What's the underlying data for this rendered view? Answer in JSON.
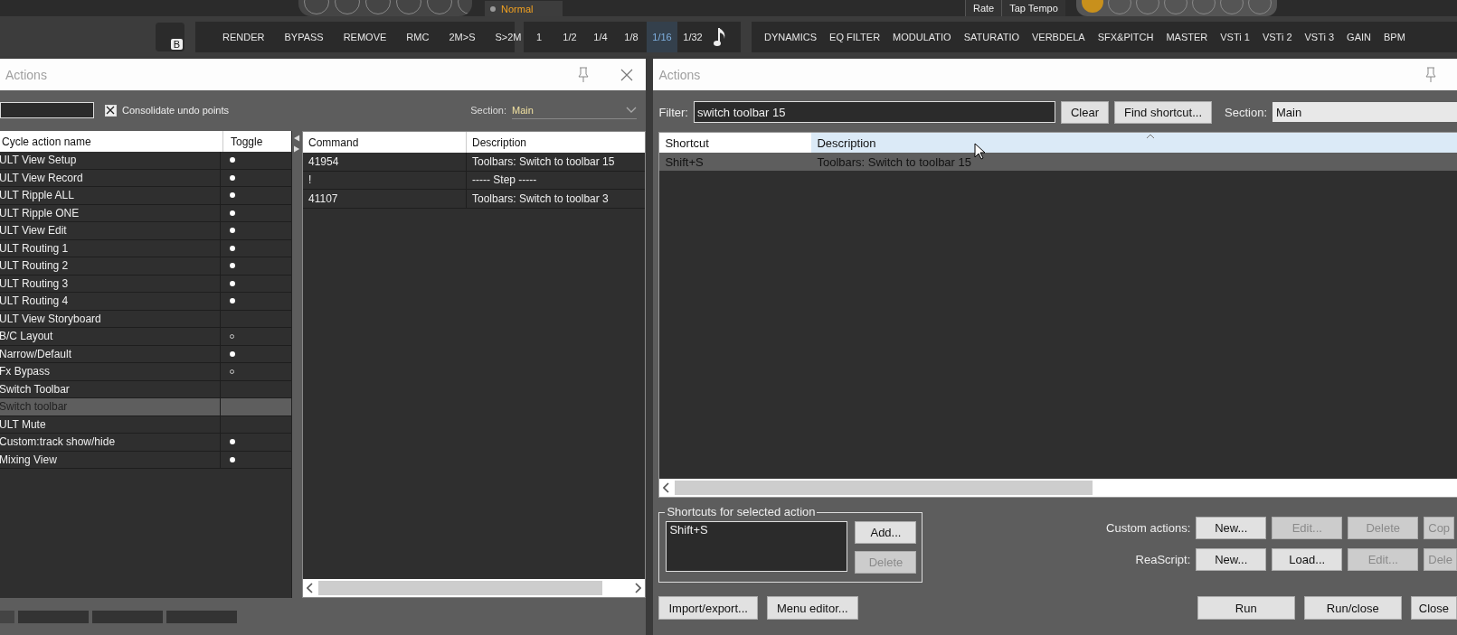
{
  "top_bar": {
    "mode": "Normal",
    "buttons": [
      "Rate",
      "Tap Tempo"
    ]
  },
  "toolbar": {
    "badge": "B",
    "actions": [
      "RENDER",
      "BYPASS",
      "REMOVE",
      "RMC",
      "2M>S",
      "S>2M"
    ],
    "grid": [
      {
        "label": "1",
        "selected": false
      },
      {
        "label": "1/2",
        "selected": false
      },
      {
        "label": "1/4",
        "selected": false
      },
      {
        "label": "1/8",
        "selected": false
      },
      {
        "label": "1/16",
        "selected": true
      },
      {
        "label": "1/32",
        "selected": false
      }
    ],
    "fx": [
      "DYNAMICS",
      "EQ FILTER",
      "MODULATIO",
      "SATURATIO",
      "VERBDELA",
      "SFX&PITCH",
      "MASTER",
      "VSTi 1",
      "VSTi 2",
      "VSTi 3",
      "GAIN",
      "BPM"
    ]
  },
  "left_window": {
    "title": "Actions",
    "consolidate": {
      "label": "Consolidate undo points",
      "checked": true
    },
    "section": {
      "label": "Section:",
      "value": "Main"
    },
    "cycle_table": {
      "columns": [
        "Cycle action name",
        "Toggle"
      ],
      "rows": [
        {
          "name": "ULT View Setup",
          "toggle_on": true,
          "selected": false
        },
        {
          "name": "ULT View Record",
          "toggle_on": true,
          "selected": false
        },
        {
          "name": "ULT Ripple ALL",
          "toggle_on": true,
          "selected": false
        },
        {
          "name": "ULT Ripple ONE",
          "toggle_on": true,
          "selected": false
        },
        {
          "name": "ULT View Edit",
          "toggle_on": true,
          "selected": false
        },
        {
          "name": "ULT Routing 1",
          "toggle_on": true,
          "selected": false
        },
        {
          "name": "ULT Routing 2",
          "toggle_on": true,
          "selected": false
        },
        {
          "name": "ULT Routing 3",
          "toggle_on": true,
          "selected": false
        },
        {
          "name": "ULT Routing 4",
          "toggle_on": true,
          "selected": false
        },
        {
          "name": "ULT View Storyboard",
          "selected": false
        },
        {
          "name": "B/C Layout",
          "toggle_on": false,
          "selected": false
        },
        {
          "name": "Narrow/Default",
          "toggle_on": true,
          "selected": false
        },
        {
          "name": "Fx Bypass",
          "toggle_on": false,
          "selected": false
        },
        {
          "name": "Switch Toolbar",
          "selected": false
        },
        {
          "name": "Switch toolbar",
          "selected": true
        },
        {
          "name": "ULT Mute",
          "selected": false
        },
        {
          "name": "Custom:track show/hide",
          "toggle_on": true,
          "selected": false
        },
        {
          "name": "Mixing View",
          "toggle_on": true,
          "selected": false
        }
      ]
    },
    "command_table": {
      "columns": [
        "Command",
        "Description"
      ],
      "rows": [
        {
          "command": "41954",
          "description": "Toolbars: Switch to toolbar 15"
        },
        {
          "command": "!",
          "description": "----- Step -----"
        },
        {
          "command": "41107",
          "description": "Toolbars: Switch to toolbar 3"
        }
      ]
    }
  },
  "right_window": {
    "title": "Actions",
    "filter": {
      "label": "Filter:",
      "value": "switch toolbar 15"
    },
    "clear": "Clear",
    "find": "Find shortcut...",
    "section": {
      "label": "Section:",
      "value": "Main"
    },
    "table": {
      "columns": [
        "Shortcut",
        "Description"
      ],
      "rows": [
        {
          "shortcut": "Shift+S",
          "description": "Toolbars: Switch to toolbar 15",
          "selected": true
        }
      ]
    },
    "shortcuts_group": {
      "title": "Shortcuts for selected action",
      "items": [
        "Shift+S"
      ],
      "add": "Add...",
      "delete": {
        "label": "Delete",
        "disabled": true
      }
    },
    "custom_actions": {
      "label": "Custom actions:",
      "buttons": [
        {
          "label": "New...",
          "disabled": false
        },
        {
          "label": "Edit...",
          "disabled": true
        },
        {
          "label": "Delete",
          "disabled": true
        },
        {
          "label": "Cop",
          "disabled": true
        }
      ]
    },
    "reascript": {
      "label": "ReaScript:",
      "buttons": [
        {
          "label": "New...",
          "disabled": false
        },
        {
          "label": "Load...",
          "disabled": false
        },
        {
          "label": "Edit...",
          "disabled": true
        },
        {
          "label": "Dele",
          "disabled": true
        }
      ]
    },
    "bottom_left": [
      "Import/export...",
      "Menu editor..."
    ],
    "bottom_right": [
      "Run",
      "Run/close",
      "Close"
    ]
  }
}
